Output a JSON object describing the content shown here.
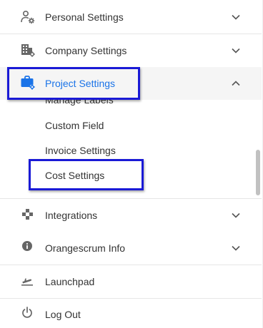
{
  "menu": {
    "personal_settings": {
      "label": "Personal Settings",
      "icon": "user-gear-icon",
      "expanded": false
    },
    "company_settings": {
      "label": "Company Settings",
      "icon": "building-gear-icon",
      "expanded": false
    },
    "project_settings": {
      "label": "Project Settings",
      "icon": "briefcase-gear-icon",
      "expanded": true,
      "items": [
        {
          "label": "Manage Labels"
        },
        {
          "label": "Custom Field"
        },
        {
          "label": "Invoice Settings"
        },
        {
          "label": "Cost Settings"
        }
      ]
    },
    "integrations": {
      "label": "Integrations",
      "icon": "integrations-icon",
      "expanded": false
    },
    "orangescrum_info": {
      "label": "Orangescrum Info",
      "icon": "info-icon",
      "expanded": false
    },
    "launchpad": {
      "label": "Launchpad",
      "icon": "takeoff-icon"
    },
    "logout": {
      "label": "Log Out",
      "icon": "power-icon"
    }
  },
  "colors": {
    "accent": "#1a73e8",
    "highlight_border": "#1a1ad6",
    "active_row_bg": "#f5f5f5",
    "text": "#333333",
    "icon": "#666666"
  }
}
